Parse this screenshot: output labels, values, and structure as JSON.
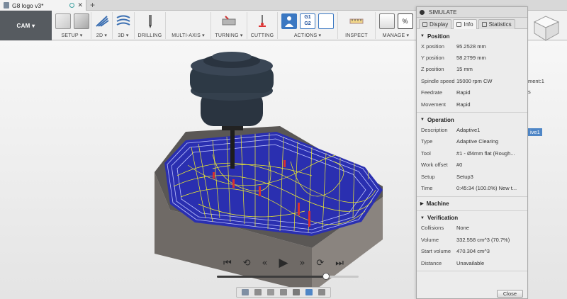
{
  "tab": {
    "title": "G8 logo v3*",
    "new_tab": "+"
  },
  "ribbon": {
    "workspace": "CAM ▾",
    "groups": [
      {
        "label": "SETUP ▾"
      },
      {
        "label": "2D ▾"
      },
      {
        "label": "3D ▾"
      },
      {
        "label": "DRILLING"
      },
      {
        "label": "MULTI-AXIS ▾"
      },
      {
        "label": "TURNING ▾"
      },
      {
        "label": "CUTTING"
      },
      {
        "label": "ACTIONS ▾"
      },
      {
        "label": "INSPECT"
      },
      {
        "label": "MANAGE ▾"
      }
    ],
    "actions_icon_text": [
      "G1",
      "G2"
    ]
  },
  "simulate": {
    "title": "SIMULATE",
    "tabs": [
      "Display",
      "Info",
      "Statistics"
    ],
    "active_tab": "Info",
    "sections": [
      {
        "title": "Position",
        "rows": [
          {
            "k": "X position",
            "v": "95.2528 mm"
          },
          {
            "k": "Y position",
            "v": "58.2799 mm"
          },
          {
            "k": "Z position",
            "v": "15 mm"
          },
          {
            "k": "Spindle speed",
            "v": "15000 rpm CW"
          },
          {
            "k": "Feedrate",
            "v": "Rapid"
          },
          {
            "k": "Movement",
            "v": "Rapid"
          }
        ]
      },
      {
        "title": "Operation",
        "rows": [
          {
            "k": "Description",
            "v": "Adaptive1"
          },
          {
            "k": "Type",
            "v": "Adaptive Clearing"
          },
          {
            "k": "Tool",
            "v": "#1 - Ø4mm flat (Rough..."
          },
          {
            "k": "Work offset",
            "v": "#0"
          },
          {
            "k": "Setup",
            "v": "Setup3"
          },
          {
            "k": "Time",
            "v": "0:45:34 (100.0%) New t..."
          }
        ]
      },
      {
        "title": "Machine",
        "collapsed": true,
        "rows": []
      },
      {
        "title": "Verification",
        "rows": [
          {
            "k": "Collisions",
            "v": "None"
          },
          {
            "k": "Volume",
            "v": "332.558 cm^3 (70.7%)"
          },
          {
            "k": "Start volume",
            "v": "470.304 cm^3"
          },
          {
            "k": "Distance",
            "v": "Unavailable"
          }
        ]
      }
    ],
    "close_label": "Close"
  },
  "browser_fragments": [
    "ment:1",
    "s",
    "ive1"
  ],
  "playback": {
    "buttons": [
      "⏮",
      "⟲",
      "«",
      "▶",
      "»",
      "⟳",
      "⏭"
    ],
    "progress": 0.77
  },
  "colors": {
    "workspace_bg": "#565b60",
    "stock_wall": "#7d7773",
    "stock_floor": "#2a2fb0",
    "toolpath": "#f2f02a",
    "gouge": "#d93030",
    "tool_body": "#2a3440",
    "selection": "#4f86c6"
  }
}
